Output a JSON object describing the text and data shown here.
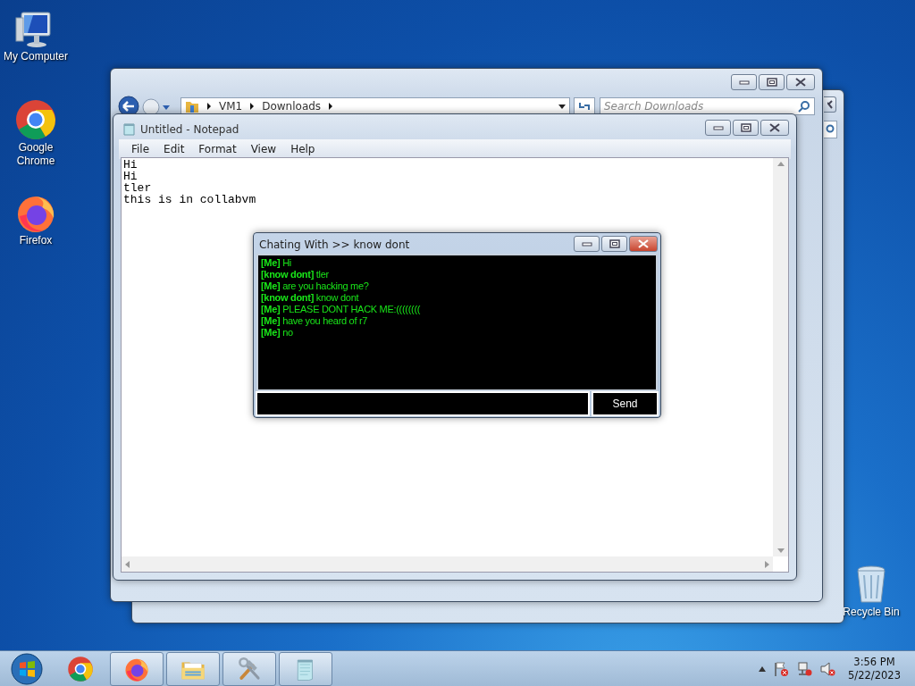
{
  "desktop_icons": [
    {
      "label": "My Computer",
      "kind": "computer"
    },
    {
      "label": "Google Chrome",
      "kind": "chrome"
    },
    {
      "label": "Firefox",
      "kind": "firefox"
    },
    {
      "label": "Recycle Bin",
      "kind": "bin"
    }
  ],
  "explorer": {
    "breadcrumb": [
      "VM1",
      "Downloads"
    ],
    "search": {
      "placeholder": "Search Downloads"
    }
  },
  "notepad": {
    "title": "Untitled - Notepad",
    "menu": [
      "File",
      "Edit",
      "Format",
      "View",
      "Help"
    ],
    "text": "Hi\nHi\ntler\nthis is in collabvm"
  },
  "chat": {
    "title": "Chating With >> know dont",
    "messages": [
      {
        "text": "**[Me]** Hi"
      },
      {
        "text": "**[know dont]** tler"
      },
      {
        "text": "**[Me]** are you hacking me?"
      },
      {
        "text": "**[know dont]** know dont"
      },
      {
        "text": "**[Me]** PLEASE DONT HACK ME:(((((((("
      },
      {
        "text": "**[Me]** have you heard of r7"
      },
      {
        "text": "**[Me]** no"
      }
    ],
    "send": "Send"
  },
  "taskbar": {
    "apps": [
      {
        "kind": "chrome",
        "running": false
      },
      {
        "kind": "firefox",
        "running": true
      },
      {
        "kind": "folder",
        "running": true
      },
      {
        "kind": "tools",
        "running": true
      },
      {
        "kind": "notepad",
        "running": true
      }
    ],
    "time": "3:56 PM",
    "date": "5/22/2023"
  }
}
